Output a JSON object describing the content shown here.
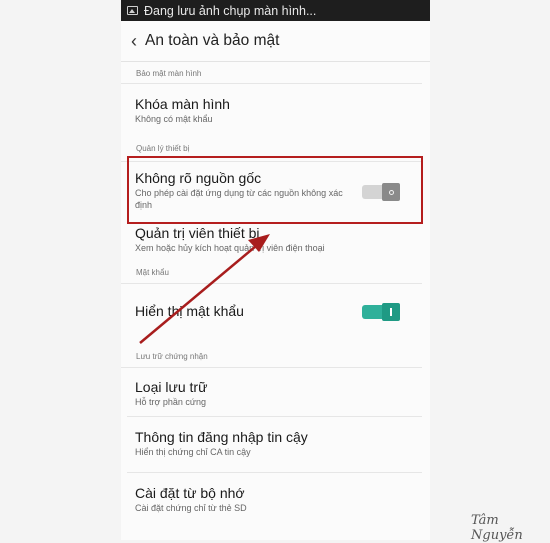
{
  "status_bar": {
    "notification_text": "Đang lưu ảnh chụp màn hình..."
  },
  "header": {
    "title": "An toàn và bảo mật"
  },
  "sections": {
    "screen_security": {
      "label": "Bảo mật màn hình",
      "lock_screen": {
        "title": "Khóa màn hình",
        "subtitle": "Không có mật khẩu"
      }
    },
    "device_admin": {
      "label": "Quản lý thiết bị",
      "unknown_sources": {
        "title": "Không rõ nguồn gốc",
        "subtitle": "Cho phép cài đặt ứng dụng từ các nguồn không xác định",
        "enabled": false
      },
      "device_administrators": {
        "title": "Quản trị viên thiết bị",
        "subtitle": "Xem hoặc hủy kích hoạt quản trị viên điện thoại"
      }
    },
    "password": {
      "label": "Mật khẩu",
      "show_password": {
        "title": "Hiển thị mật khẩu",
        "enabled": true
      }
    },
    "credential_storage": {
      "label": "Lưu trữ chứng nhận",
      "storage_type": {
        "title": "Loại lưu trữ",
        "subtitle": "Hỗ trợ phần cứng"
      },
      "trusted_credentials": {
        "title": "Thông tin đăng nhập tin cậy",
        "subtitle": "Hiển thị chứng chỉ CA tin cậy"
      },
      "install_from_storage": {
        "title": "Cài đặt từ bộ nhớ",
        "subtitle": "Cài đặt chứng chỉ từ thẻ SD"
      }
    }
  },
  "watermark": "Tâm Nguyễn",
  "colors": {
    "highlight": "#b51e1e",
    "toggle_on": "#2fb09a",
    "toggle_off": "#8a8a8a"
  }
}
